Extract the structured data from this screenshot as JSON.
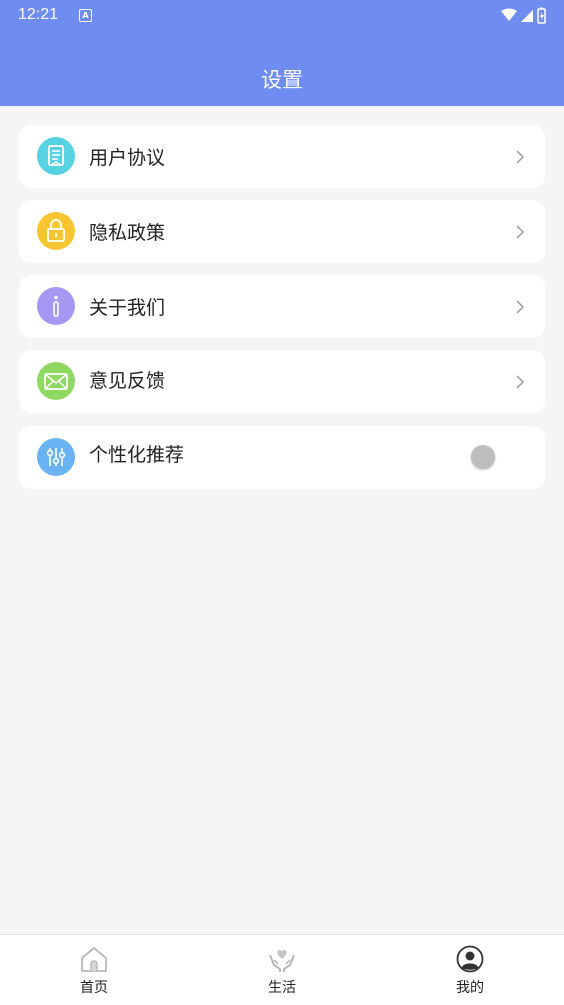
{
  "status_bar": {
    "time": "12:21"
  },
  "header": {
    "title": "设置"
  },
  "colors": {
    "primary": "#6f8cf0",
    "agreement_icon": "#57d2e3",
    "privacy_icon": "#f7c531",
    "about_icon": "#a597f2",
    "feedback_icon": "#8fd861",
    "recommend_icon": "#6ab3f3"
  },
  "settings": {
    "items": [
      {
        "label": "用户协议",
        "icon": "document-icon"
      },
      {
        "label": "隐私政策",
        "icon": "lock-icon"
      },
      {
        "label": "关于我们",
        "icon": "info-icon"
      },
      {
        "label": "意见反馈",
        "icon": "mail-icon"
      },
      {
        "label": "个性化推荐",
        "icon": "sliders-icon",
        "toggle_on": false
      }
    ]
  },
  "tabs": [
    {
      "label": "首页",
      "icon": "home-icon"
    },
    {
      "label": "生活",
      "icon": "heart-hands-icon"
    },
    {
      "label": "我的",
      "icon": "user-icon"
    }
  ]
}
